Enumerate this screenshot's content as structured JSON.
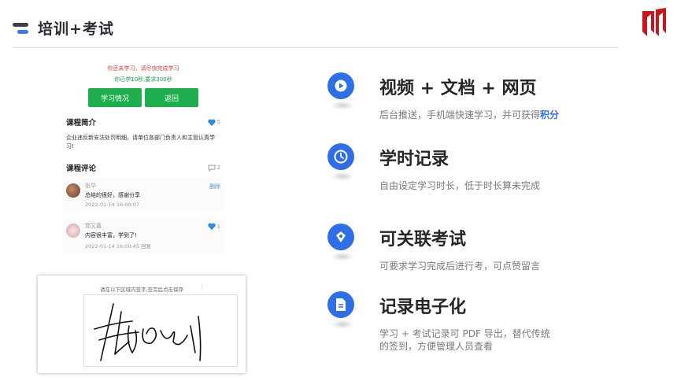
{
  "header": {
    "title": "培训+考试"
  },
  "phone": {
    "warning": "你还未学习，请尽快完成学习",
    "progress": "你已学10秒,要求300秒",
    "buttons": [
      "学习情况",
      "返回"
    ],
    "intro": {
      "heading": "课程简介",
      "likes": "5",
      "text": "企业违反新安法处罚明细，请单位各部门负责人和主管认真学习!"
    },
    "comments_section": {
      "heading": "课程评论",
      "count": "2"
    },
    "comments": [
      {
        "name": "张华",
        "text": "总结的很好，感谢分享",
        "time": "2022-01-14 16:00:07",
        "action": "删除"
      },
      {
        "name": "郭又嘉",
        "text": "内容很丰富，学到了!",
        "time": "2022-01-14 16:00:45 回复",
        "likes": "1"
      }
    ]
  },
  "signature": {
    "hint": "请在以下区域内签字,签完后点击保存"
  },
  "features": [
    {
      "icon": "play-icon",
      "title": "视频 + 文档 + 网页",
      "desc": "后台推送，手机端快速学习，并可获得",
      "highlight": "积分"
    },
    {
      "icon": "clock-icon",
      "title": "学时记录",
      "desc": "自由设定学习时长，低于时长算未完成"
    },
    {
      "icon": "pen-icon",
      "title": "可关联考试",
      "desc": "可要求学习完成后进行考，可点赞留言"
    },
    {
      "icon": "document-icon",
      "title": "记录电子化",
      "desc_line1": "学习 + 考试记录可 PDF 导出，替代传统",
      "desc_line2": "的签到，方便管理人员查看"
    }
  ],
  "colors": {
    "accent": "#2e6fe8",
    "green": "#1eae4d",
    "warning": "#d9423a",
    "logo": "#c8161d"
  }
}
